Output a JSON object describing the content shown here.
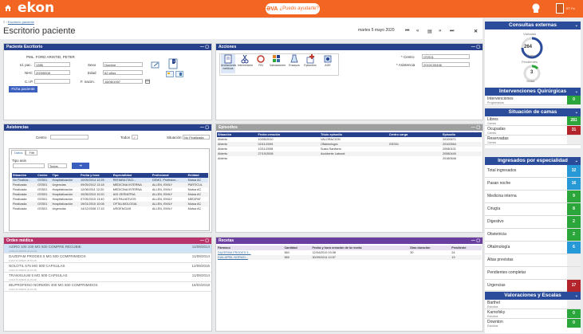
{
  "header": {
    "logo": "ekon",
    "help": "¿Puedo ayudarte?",
    "user_initials": "ET",
    "user_name": "ET Fe"
  },
  "breadcrumb": {
    "menu": "≡ ›",
    "link": "Escritorio paciente"
  },
  "page": {
    "title": "Escritorio paciente",
    "date": "martes 5 mayo 2020"
  },
  "nav": [
    "⏮",
    "«",
    "▤",
    "»",
    "⏭",
    "✕"
  ],
  "patient": {
    "title": "Paciente Escritorio",
    "name": "PML. FORD ARISTID, PETER",
    "id_label": "Id. pac.",
    "id_value": "1386",
    "nhc_label": "NHC",
    "nhc_value": "20095008",
    "cip_label": "C.I.P.",
    "sex_label": "Sexo",
    "sex_value": "Hombre",
    "age_label": "Edad",
    "age_value": "62 años",
    "birth_label": "F. nacim.",
    "birth_value": "18/06/1957",
    "button": "Ficha paciente",
    "badge": "1"
  },
  "actions": {
    "title": "Acciones",
    "items": [
      "Anotaciones médicas",
      "Intervención",
      "PAI",
      "Valoraciones",
      "Ensayos",
      "Episodios",
      "AGE"
    ],
    "center_label": "* Centro",
    "center_value": "GSS01",
    "assistance_label": "* Asistencia",
    "assistance_value": "2010C00446"
  },
  "assistances": {
    "title": "Asistencias",
    "center_label": "Centro",
    "all_label": "Todos",
    "situation_label": "Situación",
    "situation_value": "No Finalizada",
    "tabs": [
      "Datos",
      "Filtr"
    ],
    "type_label": "Tipo asis",
    "type_value": "Todos",
    "columns": [
      "Situación",
      "Centro",
      "Tipo",
      "Fecha y hora",
      "Especialidad",
      "Profesional",
      "Entidad"
    ],
    "rows": [
      [
        "No Finaliza...",
        "GSS01",
        "Hospitalización",
        "10/09/2014 12:25",
        "REHABILITACI...",
        "DEMO, Profesion...",
        "Mutua AC"
      ],
      [
        "Finalizada",
        "GSS01",
        "Urgencias",
        "09/05/2012 13:18",
        "MEDICINA INTERNA",
        "ALLEN, EMILY",
        "PARTICUL"
      ],
      [
        "Finalizada",
        "GSS01",
        "Hospitalización",
        "12/08/2011 12:20",
        "MEDICINA INTERNA",
        "ALLEN, EMILY",
        "Mutua AC"
      ],
      [
        "Finalizada",
        "GSS01",
        "Hospitalización",
        "10/05/2010 10:20",
        "AGI GERIATRIA",
        "ALLEN, EMILY",
        "Mutua AC"
      ],
      [
        "Finalizada",
        "GSS01",
        "Hospitalización",
        "07/05/2010 13:40",
        "ASI PALIATIVOS",
        "ALLEN, EMILY",
        "MEDIPAT"
      ],
      [
        "Finalizada",
        "GSS01",
        "Hospitalización",
        "19/01/2010 10:08",
        "OFTALMOLOGIA",
        "ALLEN, EMILY",
        "Mutua AC"
      ],
      [
        "Finalizada",
        "GSS01",
        "Urgencias",
        "14/12/2008 17:15",
        "URGENCIAS",
        "ALLEN, EMILY",
        "Mutua AC"
      ]
    ]
  },
  "episodes": {
    "title": "Episodios",
    "columns": [
      "Situación",
      "Fecha creación",
      "Título episodio",
      "Centro carga",
      "Episodio"
    ],
    "rows": [
      [
        "Abierto",
        "10/05/2010",
        "VALORACION",
        "",
        "20100671"
      ],
      [
        "Abierto",
        "02/11/2009",
        "Oftalmología",
        "GSS01",
        "20100564"
      ],
      [
        "Abierto",
        "10/11/2008",
        "Susto Sanitario",
        "",
        "20080101"
      ],
      [
        "Abierto",
        "27/10/2008",
        "Accidente Laboral",
        "",
        "20080440"
      ],
      [
        "Abierto",
        "",
        "",
        "",
        "20180646"
      ]
    ]
  },
  "orders": {
    "title": "Orden médica",
    "items": [
      {
        "text": "AZIRO 100 100 MG 500 COMPRE RECUBIE",
        "sub": "CADA 8 HORAS (8-16-24)",
        "date": "11/09/2014"
      },
      {
        "text": "DAZEPAM PRODES 5 MG 500 COMPRIMIDOS",
        "sub": "CADA 8 HORAS (8-16-24)",
        "date": "11/09/2014"
      },
      {
        "text": "NOLOTIL 575 MG 500 CAPSULAS",
        "sub": "CADA 8 HORAS (8-16-24)",
        "date": "12/09/2015"
      },
      {
        "text": "TRANXILIUM 5 MG 500 CAPSULAS",
        "sub": "CADA 8 HORAS (8-16-24)",
        "date": "11/09/2014"
      },
      {
        "text": "IBUPROFENO NORMON 400 MG 500 COMPRIMIDOS",
        "sub": "CADA 8 HORAS (8-16-24)",
        "date": "16/04/2018"
      }
    ]
  },
  "recipes": {
    "title": "Recetas",
    "columns": [
      "Fármaco",
      "Cantidad",
      "Fecha y hora creación de la receta",
      "Días duración",
      "Pendiente"
    ],
    "rows": [
      [
        "DAZEPAM PRODES 5...",
        "560",
        "12/04/2019 15:38",
        "30",
        "24"
      ],
      [
        "DIALAPRIL NORMO...",
        "565",
        "30/09/2014 10:57",
        "",
        "13"
      ]
    ]
  },
  "right": {
    "consultas": {
      "title": "Consultas externas",
      "visited_label": "Visitadas",
      "visited_value": "264",
      "visited_sub": "Visitas",
      "pending_label": "Pendientes",
      "pending_value": "3",
      "pending_sub": "Visitas"
    },
    "quirurgicas": {
      "title": "Intervenciones Quirúrgicas",
      "rows": [
        {
          "label": "Intervenciones",
          "sub": "Programadas",
          "value": "0",
          "color": "g"
        }
      ]
    },
    "camas": {
      "title": "Situación de camas",
      "rows": [
        {
          "label": "Libres",
          "sub": "Camas",
          "value": "281",
          "color": "g"
        },
        {
          "label": "Ocupadas",
          "sub": "Camas",
          "value": "31",
          "color": "r"
        },
        {
          "label": "Reservadas",
          "sub": "Camas",
          "value": "",
          "color": "gr"
        }
      ]
    },
    "especialidad": {
      "title": "Ingresados por especialidad",
      "rows": [
        {
          "label": "Total ingresados",
          "value": "32",
          "color": "b"
        },
        {
          "label": "Pasan noche",
          "value": "16",
          "color": "b"
        },
        {
          "label": "Medicina interna",
          "value": "9",
          "color": "g"
        },
        {
          "label": "Cirugía",
          "value": "8",
          "color": "g"
        },
        {
          "label": "Digestivo",
          "value": "2",
          "color": "g"
        },
        {
          "label": "Obstetricia",
          "value": "2",
          "color": "g"
        },
        {
          "label": "Oftalmología",
          "value": "6",
          "color": "b"
        },
        {
          "label": "Altas previstas",
          "value": "",
          "color": "gr"
        },
        {
          "label": "Pendientes completar",
          "value": "",
          "color": "gr"
        },
        {
          "label": "Urgencias",
          "value": "17",
          "color": "r"
        }
      ]
    },
    "escalas": {
      "title": "Valoraciones y Escalas",
      "rows": [
        {
          "label": "Barthel",
          "sub": "Estudios",
          "value": "",
          "color": "gr"
        },
        {
          "label": "Karnofsky",
          "sub": "Estudios",
          "value": "0",
          "color": "g"
        },
        {
          "label": "Downton",
          "sub": "Estudios",
          "value": "0",
          "color": "g"
        }
      ]
    }
  },
  "colors": {
    "brand": "#f26522",
    "navy": "#27408b",
    "pink": "#b8336a",
    "purple": "#6b3fa0"
  }
}
